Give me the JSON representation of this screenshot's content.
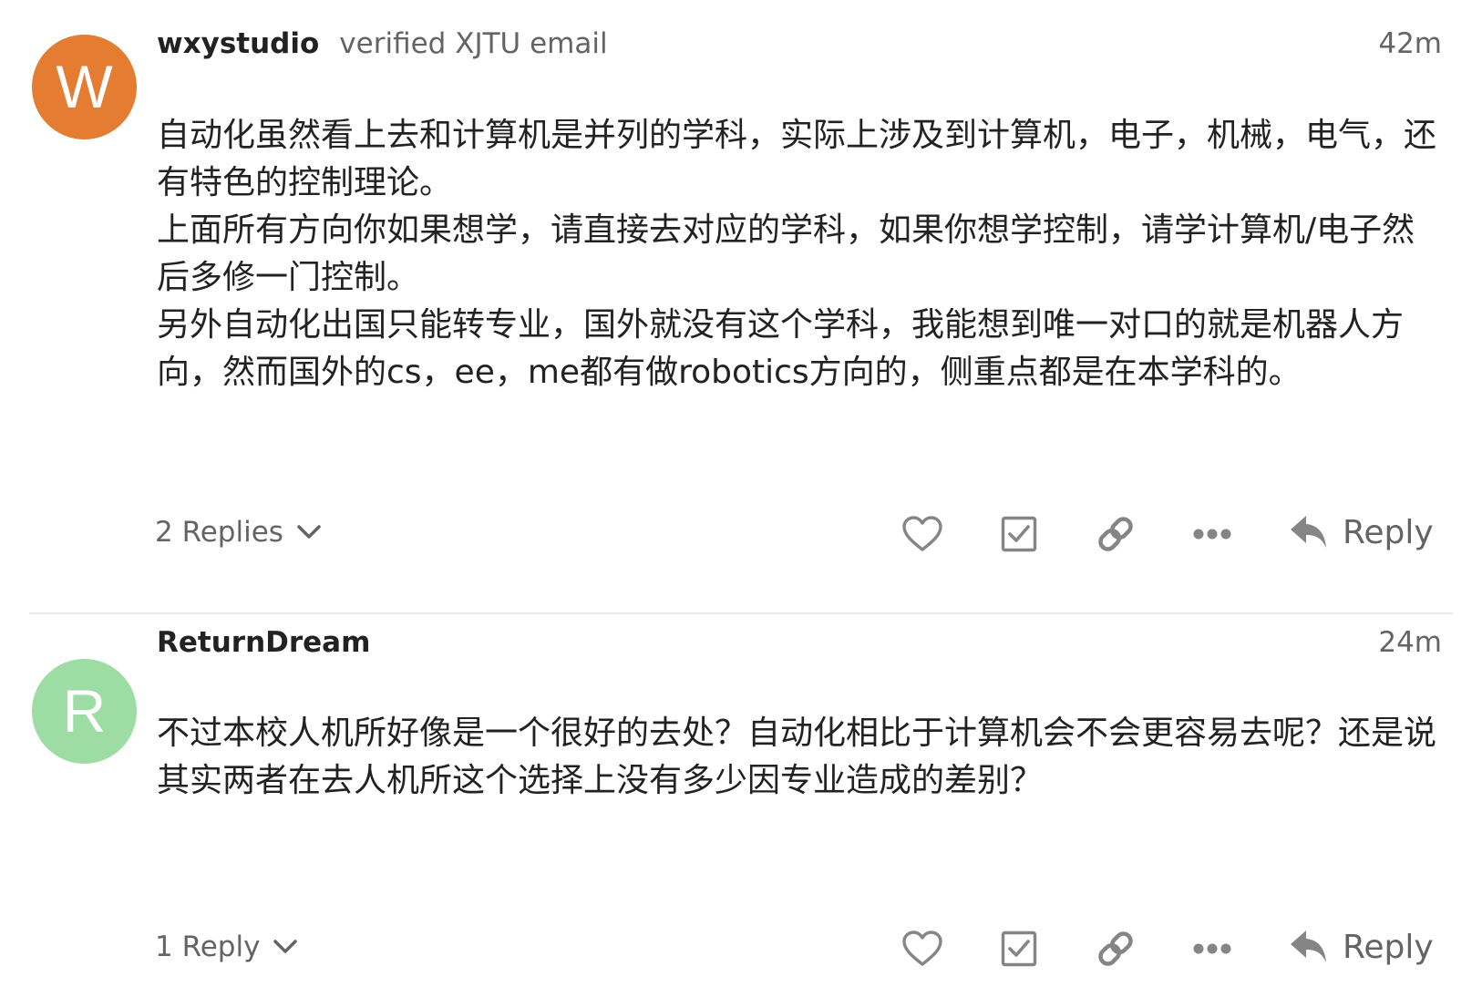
{
  "posts": [
    {
      "avatar_letter": "W",
      "avatar_color": "#e47c31",
      "username": "wxystudio",
      "user_title": "verified XJTU email",
      "timestamp": "42m",
      "body": [
        "自动化虽然看上去和计算机是并列的学科，实际上涉及到计算机，电子，机械，电气，还有特色的控制理论。",
        "上面所有方向你如果想学，请直接去对应的学科，如果你想学控制，请学计算机/电子然后多修一门控制。",
        "另外自动化出国只能转专业，国外就没有这个学科，我能想到唯一对口的就是机器人方向，然而国外的cs，ee，me都有做robotics方向的，侧重点都是在本学科的。"
      ],
      "replies_label": "2 Replies",
      "reply_label": "Reply"
    },
    {
      "avatar_letter": "R",
      "avatar_color": "#9ddda4",
      "username": "ReturnDream",
      "user_title": "",
      "timestamp": "24m",
      "body": [
        "不过本校人机所好像是一个很好的去处？自动化相比于计算机会不会更容易去呢？还是说其实两者在去人机所这个选择上没有多少因专业造成的差别？"
      ],
      "replies_label": "1 Reply",
      "reply_label": "Reply"
    }
  ],
  "icons": {
    "like": "heart-icon",
    "solve": "checkbox-icon",
    "share": "link-icon",
    "more": "ellipsis-icon",
    "reply": "reply-arrow-icon",
    "expand": "chevron-down-icon"
  },
  "colors": {
    "text": "#222222",
    "muted": "#646464",
    "icon": "#858585",
    "divider": "#e9e9e9"
  }
}
